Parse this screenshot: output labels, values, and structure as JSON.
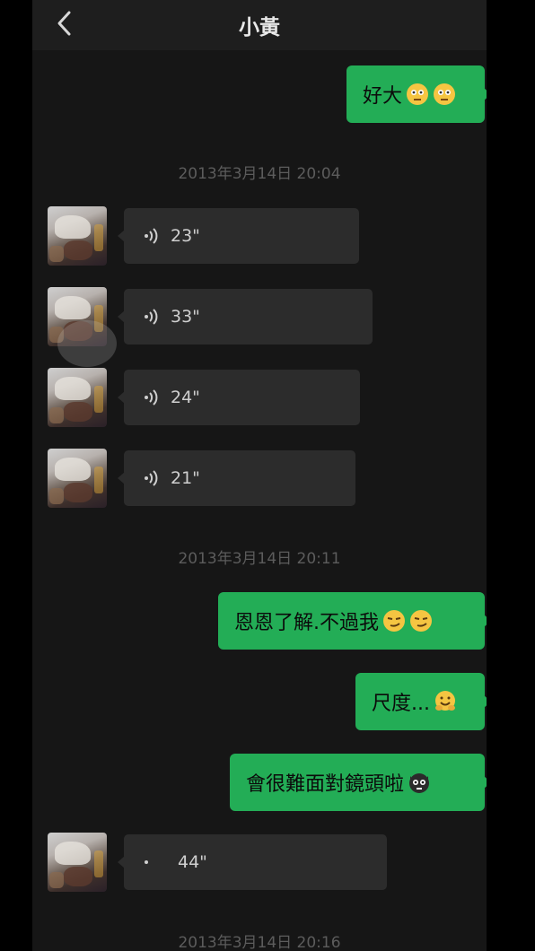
{
  "header": {
    "title": "小黃",
    "back_icon": "chevron-left-icon"
  },
  "colors": {
    "outgoing_bubble": "#23ad56",
    "incoming_bubble": "#2c2c2c",
    "background": "#161616"
  },
  "messages": {
    "out1": {
      "text": "好大",
      "emojis": [
        "flushed-emoji",
        "flushed-emoji"
      ]
    },
    "ts1": "2013年3月14日 20:04",
    "voice1": {
      "duration": "23\""
    },
    "voice2": {
      "duration": "33\""
    },
    "voice3": {
      "duration": "24\""
    },
    "voice4": {
      "duration": "21\""
    },
    "ts2": "2013年3月14日 20:11",
    "out2": {
      "text": "恩恩了解.不過我",
      "emojis": [
        "smirk-emoji",
        "smirk-emoji"
      ]
    },
    "out3": {
      "text": "尺度...",
      "emojis": [
        "hug-emoji"
      ]
    },
    "out4": {
      "text": "會很難面對鏡頭啦",
      "emojis": [
        "cat-emoji"
      ]
    },
    "voice5": {
      "duration": "44\""
    },
    "ts3": "2013年3月14日 20:16"
  }
}
